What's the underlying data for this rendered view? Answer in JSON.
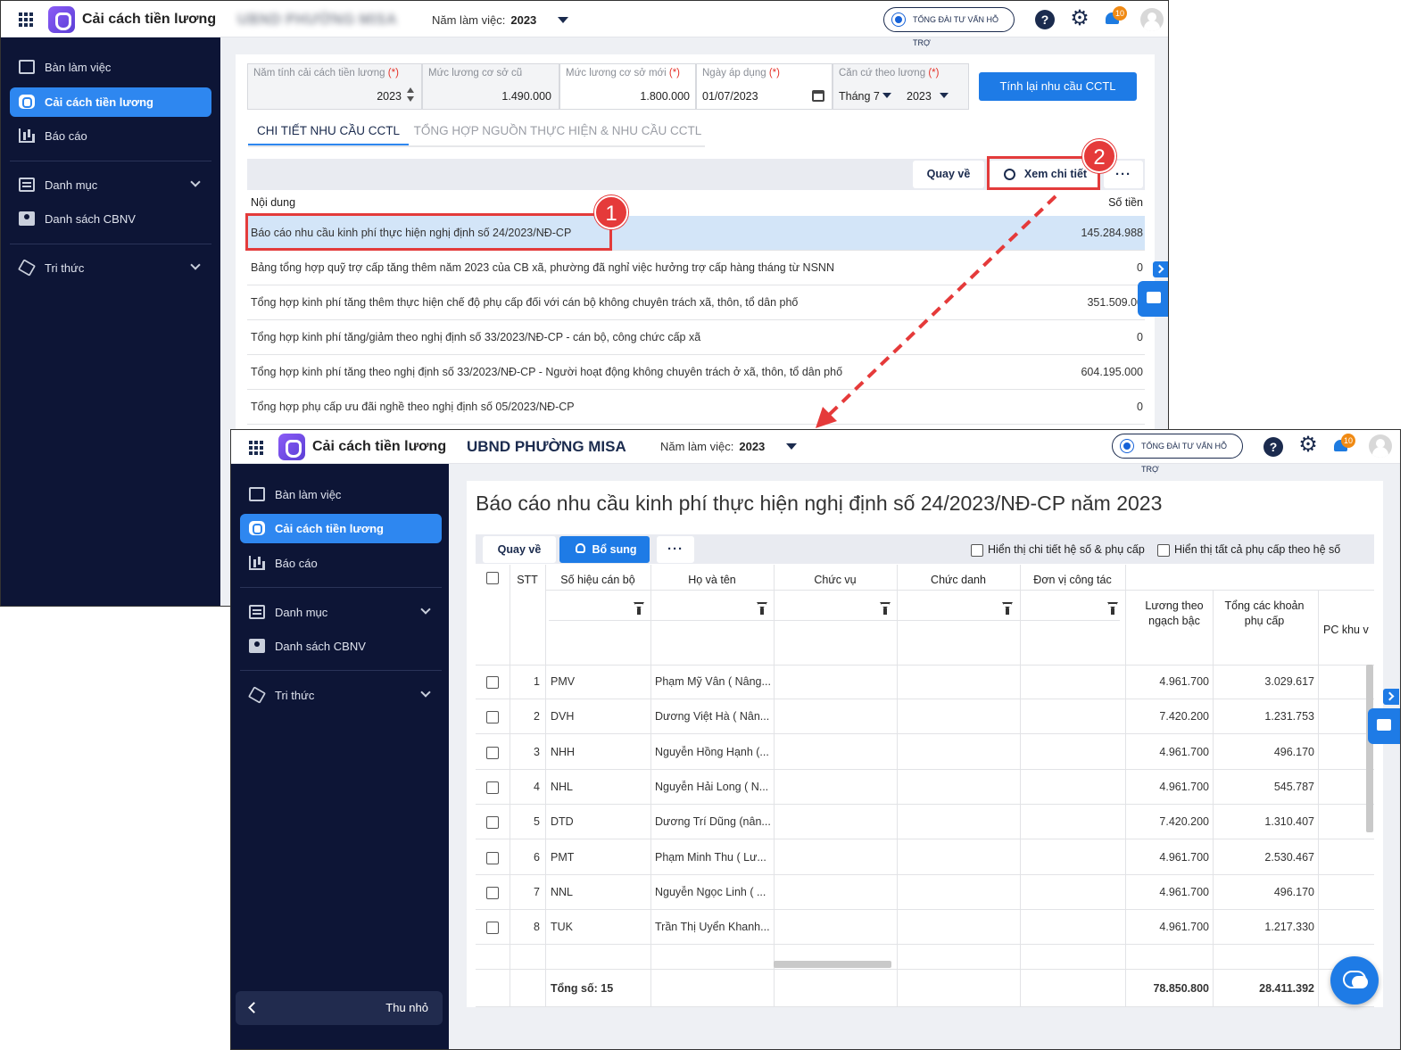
{
  "app": {
    "title": "Cải cách tiền lương",
    "org": "UBND PHƯỜNG MISA",
    "year_label": "Năm làm việc:",
    "year": "2023",
    "support": "TỔNG ĐÀI TƯ VẤN HỖ TRỢ",
    "help": "?",
    "notif_count": "10"
  },
  "sidebar": {
    "items": [
      {
        "label": "Bàn làm việc",
        "icon": "desk-icon"
      },
      {
        "label": "Cải cách tiền lương",
        "icon": "salary-reform-icon"
      },
      {
        "label": "Báo cáo",
        "icon": "report-icon"
      },
      {
        "label": "Danh mục",
        "icon": "list-icon"
      },
      {
        "label": "Danh sách CBNV",
        "icon": "staff-icon"
      },
      {
        "label": "Tri thức",
        "icon": "knowledge-icon"
      }
    ],
    "collapse": "Thu nhỏ"
  },
  "params": {
    "year_calc": {
      "label": "Năm tính cải cách tiền lương",
      "req": "(*)",
      "value": "2023"
    },
    "old_base": {
      "label": "Mức lương cơ sở cũ",
      "value": "1.490.000"
    },
    "new_base": {
      "label": "Mức lương cơ sở mới",
      "req": "(*)",
      "value": "1.800.000"
    },
    "apply_date": {
      "label": "Ngày áp dụng",
      "req": "(*)",
      "value": "01/07/2023"
    },
    "basis": {
      "label": "Căn cứ theo lương",
      "req": "(*)",
      "month": "Tháng 7",
      "year": "2023"
    },
    "recalc": "Tính lại nhu cầu CCTL"
  },
  "tabs": [
    "CHI TIẾT NHU CẦU CCTL",
    "TỔNG HỢP NGUỒN THỰC HIỆN & NHU CẦU CCTL"
  ],
  "toolbar": {
    "back": "Quay về",
    "view": "Xem chi tiết",
    "more": "···"
  },
  "list": {
    "col_content": "Nội dung",
    "col_amount": "Số tiền",
    "rows": [
      {
        "content": "Báo cáo nhu cầu kinh phí thực hiện nghị định số 24/2023/NĐ-CP",
        "amount": "145.284.988"
      },
      {
        "content": "Bảng tổng hợp quỹ trợ cấp tăng thêm năm 2023 của CB xã, phường đã nghỉ việc hưởng trợ cấp hàng tháng từ NSNN",
        "amount": "0"
      },
      {
        "content": "Tổng hợp kinh phí tăng thêm thực hiện chế độ phụ cấp đối với cán bộ không chuyên trách xã, thôn, tổ dân phố",
        "amount": "351.509.00"
      },
      {
        "content": "Tổng hợp kinh phí tăng/giảm theo nghị định số 33/2023/NĐ-CP - cán bộ, công chức cấp xã",
        "amount": "0"
      },
      {
        "content": "Tổng hợp kinh phí tăng theo nghị định số 33/2023/NĐ-CP - Người hoạt động không chuyên trách ở xã, thôn, tổ dân phố",
        "amount": "604.195.000"
      },
      {
        "content": "Tổng hợp phụ cấp ưu đãi nghề theo nghị định số 05/2023/NĐ-CP",
        "amount": "0"
      }
    ]
  },
  "markers": [
    "1",
    "2"
  ],
  "report": {
    "title": "Báo cáo nhu cầu kinh phí thực hiện nghị định số 24/2023/NĐ-CP năm 2023",
    "back": "Quay về",
    "add": "Bổ sung",
    "more": "···",
    "opt1": "Hiển thị chi tiết hệ số & phụ cấp",
    "opt2": "Hiển thị tất cả phụ cấp theo hệ số",
    "headers": {
      "stt": "STT",
      "code": "Số hiệu cán bộ",
      "name": "Họ và tên",
      "position": "Chức vụ",
      "title": "Chức danh",
      "unit": "Đơn vị công tác",
      "salary": "Lương theo ngạch bậc",
      "allow": "Tổng các khoản phụ cấp",
      "region": "PC khu v"
    },
    "rows": [
      {
        "stt": "1",
        "code": "PMV",
        "name": "Phạm Mỹ Vân ( Nâng...",
        "salary": "4.961.700",
        "allow": "3.029.617"
      },
      {
        "stt": "2",
        "code": "DVH",
        "name": "Dương Việt Hà ( Nân...",
        "salary": "7.420.200",
        "allow": "1.231.753"
      },
      {
        "stt": "3",
        "code": "NHH",
        "name": "Nguyễn Hồng Hạnh (...",
        "salary": "4.961.700",
        "allow": "496.170"
      },
      {
        "stt": "4",
        "code": "NHL",
        "name": "Nguyễn Hải Long ( N...",
        "salary": "4.961.700",
        "allow": "545.787"
      },
      {
        "stt": "5",
        "code": "DTD",
        "name": "Dương Trí Dũng (nân...",
        "salary": "7.420.200",
        "allow": "1.310.407"
      },
      {
        "stt": "6",
        "code": "PMT",
        "name": "Phạm Minh Thu ( Lư...",
        "salary": "4.961.700",
        "allow": "2.530.467"
      },
      {
        "stt": "7",
        "code": "NNL",
        "name": "Nguyễn Ngọc Linh ( ...",
        "salary": "4.961.700",
        "allow": "496.170"
      },
      {
        "stt": "8",
        "code": "TUK",
        "name": "Trần Thị Uyển Khanh...",
        "salary": "4.961.700",
        "allow": "1.217.330"
      }
    ],
    "total_label": "Tổng số: 15",
    "total_salary": "78.850.800",
    "total_allow": "28.411.392"
  },
  "colors": {
    "accent": "#2e87f0",
    "sidebar": "#0d1536",
    "highlight": "#e33b3b",
    "selected_row": "#d3e5f8"
  }
}
